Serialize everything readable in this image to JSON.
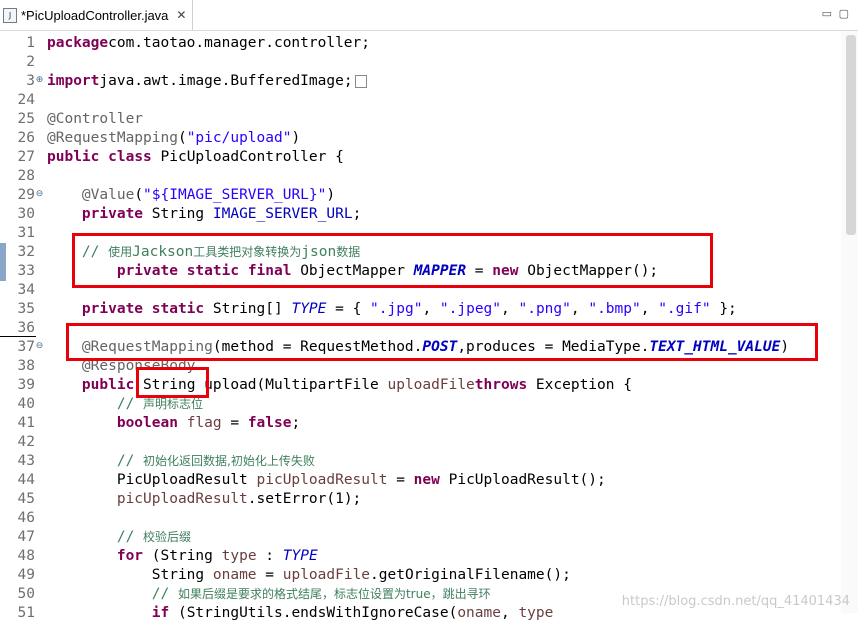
{
  "tab": {
    "title": "*PicUploadController.java",
    "icon": "java-file-icon",
    "close": "✕"
  },
  "window_buttons": {
    "minimize": "▭",
    "maximize": "▢"
  },
  "lines": [
    {
      "n": "1",
      "tokens": [
        [
          "kw",
          "package"
        ],
        [
          "",
          "com.taotao.manager.controller;"
        ]
      ]
    },
    {
      "n": "2",
      "tokens": []
    },
    {
      "n": "3",
      "fold": "⊕",
      "tokens": [
        [
          "kw",
          "import"
        ],
        [
          "",
          "java.awt.image.BufferedImage;"
        ]
      ],
      "folded": true
    },
    {
      "n": "24",
      "tokens": []
    },
    {
      "n": "25",
      "tokens": [
        [
          "ann",
          "@Controller"
        ]
      ]
    },
    {
      "n": "26",
      "tokens": [
        [
          "ann",
          "@RequestMapping"
        ],
        [
          "",
          "("
        ],
        [
          "str",
          "\"pic/upload\""
        ],
        [
          "",
          ")"
        ]
      ]
    },
    {
      "n": "27",
      "tokens": [
        [
          "kw",
          "public"
        ],
        [
          "",
          " "
        ],
        [
          "kw",
          "class"
        ],
        [
          "",
          " PicUploadController {"
        ]
      ]
    },
    {
      "n": "28",
      "tokens": []
    },
    {
      "n": "29",
      "fold": "⊖",
      "tokens": [
        [
          "",
          "    "
        ],
        [
          "ann",
          "@Value"
        ],
        [
          "",
          "("
        ],
        [
          "str",
          "\"${IMAGE_SERVER_URL}\""
        ],
        [
          "",
          ")"
        ]
      ]
    },
    {
      "n": "30",
      "tokens": [
        [
          "",
          "    "
        ],
        [
          "kw",
          "private"
        ],
        [
          "",
          " String "
        ],
        [
          "fld",
          "IMAGE_SERVER_URL"
        ],
        [
          "",
          ";"
        ]
      ]
    },
    {
      "n": "31",
      "tokens": []
    },
    {
      "n": "32",
      "tokens": [
        [
          "",
          "    "
        ],
        [
          "cmm",
          "// "
        ],
        [
          "cm",
          "使用"
        ],
        [
          "cmm",
          "Jackson"
        ],
        [
          "cm",
          "工具类把对象转换为"
        ],
        [
          "cmm",
          "json"
        ],
        [
          "cm",
          "数据"
        ]
      ]
    },
    {
      "n": "33",
      "tokens": [
        [
          "",
          "        "
        ],
        [
          "kw",
          "private"
        ],
        [
          "",
          " "
        ],
        [
          "kw",
          "static"
        ],
        [
          "",
          " "
        ],
        [
          "kw",
          "final"
        ],
        [
          "",
          " ObjectMapper "
        ],
        [
          "cst",
          "MAPPER"
        ],
        [
          "",
          " = "
        ],
        [
          "kw",
          "new"
        ],
        [
          "",
          " ObjectMapper();"
        ]
      ]
    },
    {
      "n": "34",
      "tokens": []
    },
    {
      "n": "35",
      "tokens": [
        [
          "",
          "    "
        ],
        [
          "kw",
          "private"
        ],
        [
          "",
          " "
        ],
        [
          "kw",
          "static"
        ],
        [
          "",
          " String[] "
        ],
        [
          "ital",
          "TYPE"
        ],
        [
          "",
          " = { "
        ],
        [
          "str",
          "\".jpg\""
        ],
        [
          "",
          ", "
        ],
        [
          "str",
          "\".jpeg\""
        ],
        [
          "",
          ", "
        ],
        [
          "str",
          "\".png\""
        ],
        [
          "",
          ", "
        ],
        [
          "str",
          "\".bmp\""
        ],
        [
          "",
          ", "
        ],
        [
          "str",
          "\".gif\""
        ],
        [
          "",
          " };"
        ]
      ]
    },
    {
      "n": "36",
      "tokens": []
    },
    {
      "n": "37",
      "fold": "⊖",
      "tokens": [
        [
          "",
          "    "
        ],
        [
          "ann",
          "@RequestMapping"
        ],
        [
          "",
          "(method = RequestMethod."
        ],
        [
          "cst",
          "POST"
        ],
        [
          "",
          ",produces = MediaType."
        ],
        [
          "cst",
          "TEXT_HTML_VALUE"
        ],
        [
          "",
          ")"
        ]
      ]
    },
    {
      "n": "38",
      "tokens": [
        [
          "",
          "    "
        ],
        [
          "ann",
          "@ResponseBody"
        ]
      ]
    },
    {
      "n": "39",
      "tokens": [
        [
          "",
          "    "
        ],
        [
          "kw",
          "public"
        ],
        [
          "",
          " String upload(MultipartFile "
        ],
        [
          "var",
          "uploadFile"
        ],
        [
          ") "
        ],
        [
          "kw",
          "throws"
        ],
        [
          "",
          " Exception {"
        ]
      ]
    },
    {
      "n": "40",
      "tokens": [
        [
          "",
          "        "
        ],
        [
          "cmm",
          "// "
        ],
        [
          "cm",
          "声明标志位"
        ]
      ]
    },
    {
      "n": "41",
      "tokens": [
        [
          "",
          "        "
        ],
        [
          "kw",
          "boolean"
        ],
        [
          "",
          " "
        ],
        [
          "var",
          "flag"
        ],
        [
          "",
          " = "
        ],
        [
          "kw",
          "false"
        ],
        [
          "",
          ";"
        ]
      ]
    },
    {
      "n": "42",
      "tokens": []
    },
    {
      "n": "43",
      "tokens": [
        [
          "",
          "        "
        ],
        [
          "cmm",
          "// "
        ],
        [
          "cm",
          "初始化返回数据,初始化上传失败"
        ]
      ]
    },
    {
      "n": "44",
      "tokens": [
        [
          "",
          "        PicUploadResult "
        ],
        [
          "var",
          "picUploadResult"
        ],
        [
          "",
          " = "
        ],
        [
          "kw",
          "new"
        ],
        [
          "",
          " PicUploadResult();"
        ]
      ]
    },
    {
      "n": "45",
      "tokens": [
        [
          "",
          "        "
        ],
        [
          "var",
          "picUploadResult"
        ],
        [
          "",
          ".setError(1);"
        ]
      ]
    },
    {
      "n": "46",
      "tokens": []
    },
    {
      "n": "47",
      "tokens": [
        [
          "",
          "        "
        ],
        [
          "cmm",
          "// "
        ],
        [
          "cm",
          "校验后缀"
        ]
      ]
    },
    {
      "n": "48",
      "tokens": [
        [
          "",
          "        "
        ],
        [
          "kw",
          "for"
        ],
        [
          "",
          " (String "
        ],
        [
          "var",
          "type"
        ],
        [
          "",
          " : "
        ],
        [
          "ital",
          "TYPE"
        ],
        [
          ") {"
        ]
      ]
    },
    {
      "n": "49",
      "tokens": [
        [
          "",
          "            String "
        ],
        [
          "var",
          "oname"
        ],
        [
          "",
          " = "
        ],
        [
          "var",
          "uploadFile"
        ],
        [
          "",
          ".getOriginalFilename();"
        ]
      ]
    },
    {
      "n": "50",
      "tokens": [
        [
          "",
          "            "
        ],
        [
          "cmm",
          "// "
        ],
        [
          "cm",
          "如果后缀是要求的格式结尾，标志位设置为true，跳出寻环"
        ]
      ]
    },
    {
      "n": "51",
      "tokens": [
        [
          "",
          "            "
        ],
        [
          "kw",
          "if"
        ],
        [
          "",
          " (StringUtils.endsWithIgnoreCase("
        ],
        [
          "var",
          "oname"
        ],
        [
          "",
          ", "
        ],
        [
          "var",
          "type"
        ],
        [
          ")) {"
        ]
      ]
    }
  ],
  "watermark": "https://blog.csdn.net/qq_41401434"
}
